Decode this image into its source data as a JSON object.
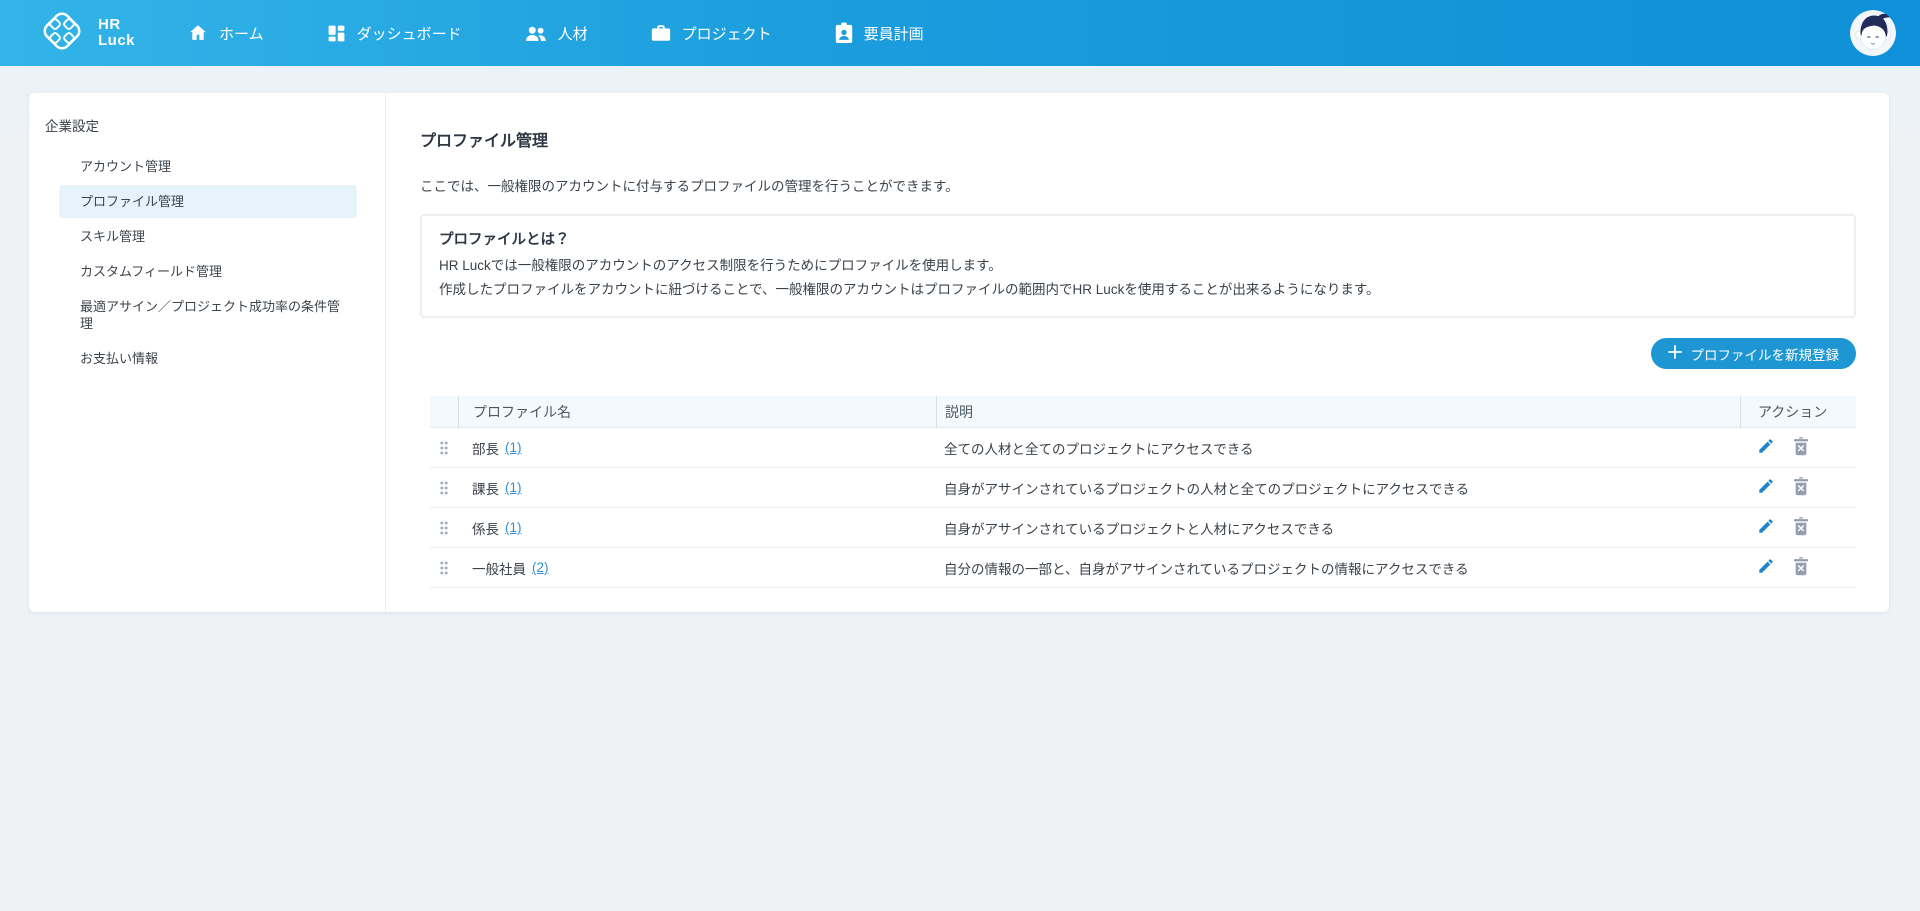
{
  "nav": {
    "logo_line1": "HR",
    "logo_line2": "Luck",
    "items": [
      {
        "label": "ホーム",
        "icon": "home-icon"
      },
      {
        "label": "ダッシュボード",
        "icon": "dashboard-icon"
      },
      {
        "label": "人材",
        "icon": "people-icon"
      },
      {
        "label": "プロジェクト",
        "icon": "briefcase-icon"
      },
      {
        "label": "要員計画",
        "icon": "badge-icon"
      }
    ]
  },
  "sidebar": {
    "section_title": "企業設定",
    "items": [
      {
        "label": "アカウント管理",
        "active": false
      },
      {
        "label": "プロファイル管理",
        "active": true
      },
      {
        "label": "スキル管理",
        "active": false
      },
      {
        "label": "カスタムフィールド管理",
        "active": false
      },
      {
        "label": "最適アサイン／プロジェクト成功率の条件管理",
        "active": false
      },
      {
        "label": "お支払い情報",
        "active": false
      }
    ]
  },
  "main": {
    "title": "プロファイル管理",
    "subtitle": "ここでは、一般権限のアカウントに付与するプロファイルの管理を行うことができます。",
    "info_box": {
      "title": "プロファイルとは？",
      "lines": [
        "HR Luckでは一般権限のアカウントのアクセス制限を行うためにプロファイルを使用します。",
        "作成したプロファイルをアカウントに紐づけることで、一般権限のアカウントはプロファイルの範囲内でHR Luckを使用することが出来るようになります。"
      ]
    },
    "add_button_label": "プロファイルを新規登録",
    "table": {
      "headers": {
        "name": "プロファイル名",
        "description": "説明",
        "actions": "アクション"
      },
      "rows": [
        {
          "name": "部長",
          "count": "(1)",
          "description": "全ての人材と全てのプロジェクトにアクセスできる"
        },
        {
          "name": "課長",
          "count": "(1)",
          "description": "自身がアサインされているプロジェクトの人材と全てのプロジェクトにアクセスできる"
        },
        {
          "name": "係長",
          "count": "(1)",
          "description": "自身がアサインされているプロジェクトと人材にアクセスできる"
        },
        {
          "name": "一般社員",
          "count": "(2)",
          "description": "自分の情報の一部と、自身がアサインされているプロジェクトの情報にアクセスできる"
        }
      ]
    }
  },
  "colors": {
    "nav_gradient_left": "#33b4e8",
    "nav_gradient_right": "#1090d8",
    "accent_blue": "#1d96d3",
    "link_blue": "#2f8fd1",
    "active_item_bg": "#e7f3fb",
    "table_header_bg": "#f4f9fd",
    "trash_gray": "#959eab"
  }
}
